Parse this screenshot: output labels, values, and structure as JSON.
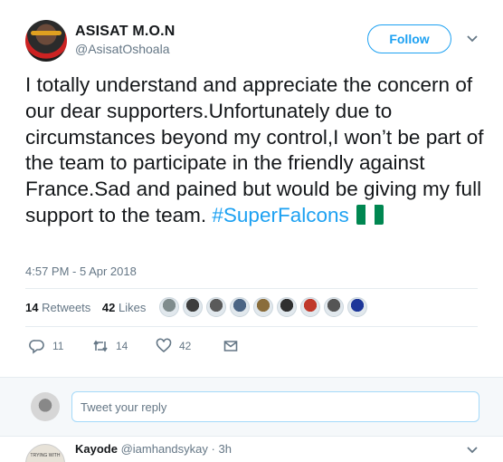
{
  "author": {
    "display_name": "ASISAT M.O.N",
    "handle": "@AsisatOshoala"
  },
  "follow_label": "Follow",
  "tweet": {
    "text": "I totally understand and appreciate the concern of our dear supporters.Unfortunately due to circumstances beyond my control,I won’t be part of the team to participate in the friendly against France.Sad and pained but would be giving my full support to the team.",
    "hashtag": "#SuperFalcons",
    "flag_colors": [
      "#008751",
      "#ffffff",
      "#008751"
    ],
    "timestamp": "4:57 PM - 5 Apr 2018"
  },
  "stats": {
    "retweets_count": "14",
    "retweets_label": "Retweets",
    "likes_count": "42",
    "likes_label": "Likes"
  },
  "liker_avatar_colors": [
    "#7f8c8d",
    "#3d3d3d",
    "#5a5a5a",
    "#4b6584",
    "#8a6d3b",
    "#2f2f2f",
    "#c0392b",
    "#555555",
    "#1e3799"
  ],
  "actions": {
    "reply_count": "11",
    "retweet_count": "14",
    "like_count": "42"
  },
  "reply": {
    "placeholder": "Tweet your reply"
  },
  "next_tweet": {
    "name": "Kayode",
    "handle": "@iamhandsykay",
    "separator": "·",
    "time": "3h",
    "avatar_text": "TRYING WITH"
  },
  "colors": {
    "accent": "#1da1f2",
    "text": "#14171a",
    "muted": "#657786"
  }
}
